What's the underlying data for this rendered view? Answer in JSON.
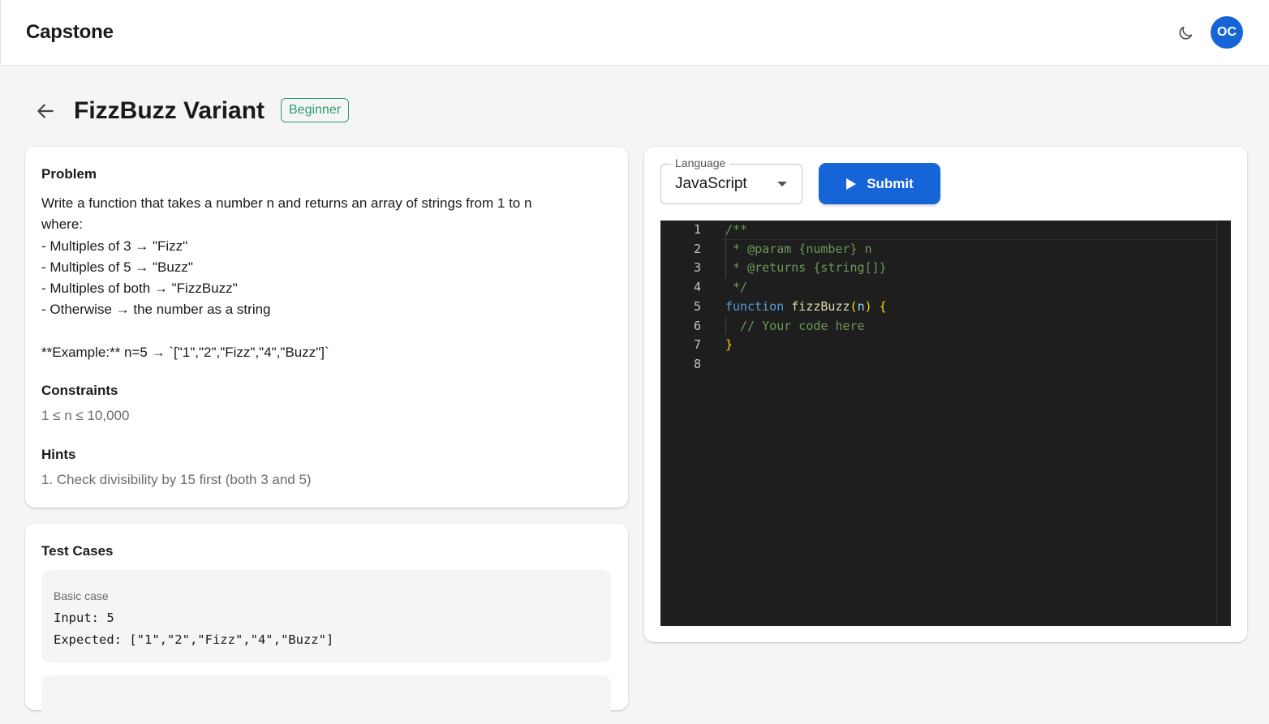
{
  "app": {
    "brand": "Capstone",
    "avatar_initials": "OC",
    "theme_icon": "moon-icon"
  },
  "challenge": {
    "title": "FizzBuzz Variant",
    "level": "Beginner"
  },
  "problem": {
    "heading": "Problem",
    "description_lines": [
      "Write a function that takes a number n and returns an array of strings from 1 to n",
      "where:",
      "- Multiples of 3 → \"Fizz\"",
      "- Multiples of 5 → \"Buzz\"",
      "- Multiples of both → \"FizzBuzz\"",
      "- Otherwise → the number as a string",
      "",
      "**Example:** n=5 → `[\"1\",\"2\",\"Fizz\",\"4\",\"Buzz\"]`"
    ],
    "constraints_heading": "Constraints",
    "constraints": "1 ≤ n ≤ 10,000",
    "hints_heading": "Hints",
    "hints": [
      "1. Check divisibility by 15 first (both 3 and 5)"
    ]
  },
  "tests": {
    "heading": "Test Cases",
    "cases": [
      {
        "label": "Basic case",
        "input": "Input: 5",
        "expected": "Expected: [\"1\",\"2\",\"Fizz\",\"4\",\"Buzz\"]"
      }
    ]
  },
  "editor": {
    "language_label": "Language",
    "language": "JavaScript",
    "submit_label": "Submit",
    "line_numbers": [
      "1",
      "2",
      "3",
      "4",
      "5",
      "6",
      "7",
      "8"
    ],
    "code": {
      "l1": "/**",
      "l2": " * @param {number} n",
      "l3": " * @returns {string[]}",
      "l4": " */",
      "l5_kw": "function",
      "l5_fn": "fizzBuzz",
      "l5_open": "(",
      "l5_param": "n",
      "l5_close": ")",
      "l5_brace": "{",
      "l6": "  // Your code here",
      "l7": "}",
      "l8": ""
    }
  }
}
